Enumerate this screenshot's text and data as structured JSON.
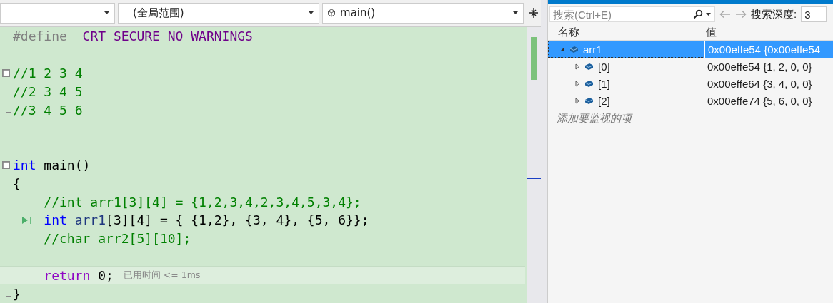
{
  "editor": {
    "nav": {
      "scope": "(全局范围)",
      "member": "main()"
    },
    "lines": [
      {
        "kind": "code",
        "tokens": [
          {
            "kind": "pre",
            "text": "#define "
          },
          {
            "kind": "macro",
            "text": "_CRT_SECURE_NO_WARNINGS"
          }
        ]
      },
      {
        "kind": "blank"
      },
      {
        "kind": "code",
        "collapsible": true,
        "tokens": [
          {
            "kind": "comment",
            "text": "//1 2 3 4"
          }
        ]
      },
      {
        "kind": "code",
        "in_region": true,
        "tokens": [
          {
            "kind": "comment",
            "text": "//2 3 4 5"
          }
        ]
      },
      {
        "kind": "code",
        "in_region": true,
        "tokens": [
          {
            "kind": "comment",
            "text": "//3 4 5 6"
          }
        ]
      },
      {
        "kind": "blank"
      },
      {
        "kind": "blank"
      },
      {
        "kind": "code",
        "collapsible": true,
        "tokens": [
          {
            "kind": "keyword",
            "text": "int"
          },
          {
            "kind": "plain",
            "text": " main()"
          }
        ]
      },
      {
        "kind": "code",
        "in_region": true,
        "tokens": [
          {
            "kind": "plain",
            "text": "{"
          }
        ]
      },
      {
        "kind": "code",
        "in_region": true,
        "indented": true,
        "tokens": [
          {
            "kind": "comment",
            "text": "//int arr1[3][4] = {1,2,3,4,2,3,4,5,3,4};"
          }
        ]
      },
      {
        "kind": "code",
        "in_region": true,
        "indented": true,
        "marker": true,
        "tokens": [
          {
            "kind": "keyword",
            "text": "int"
          },
          {
            "kind": "ident",
            "text": " arr1"
          },
          {
            "kind": "plain",
            "text": "[3][4] = { {1,2}, {3, 4}, {5, 6}};"
          }
        ]
      },
      {
        "kind": "code",
        "in_region": true,
        "indented": true,
        "tokens": [
          {
            "kind": "comment",
            "text": "//char arr2[5][10];"
          }
        ]
      },
      {
        "kind": "blank",
        "in_region": true
      },
      {
        "kind": "code",
        "in_region": true,
        "indented": true,
        "current": true,
        "tokens": [
          {
            "kind": "control",
            "text": "return"
          },
          {
            "kind": "plain",
            "text": " 0;"
          },
          {
            "kind": "hint",
            "text": "已用时间 <= 1ms"
          }
        ]
      },
      {
        "kind": "code",
        "in_region": true,
        "tokens": [
          {
            "kind": "plain",
            "text": "}"
          }
        ]
      }
    ]
  },
  "watch": {
    "search": {
      "placeholder": "搜索(Ctrl+E)"
    },
    "depth_label": "搜索深度:",
    "depth": "3",
    "columns": [
      "名称",
      "值"
    ],
    "rows": [
      {
        "name": "arr1",
        "value": "0x00effe54 {0x00effe54",
        "expanded": true,
        "selected": true,
        "children": [
          {
            "name": "[0]",
            "value": "0x00effe54 {1, 2, 0, 0}",
            "expanded": false,
            "selected": false
          },
          {
            "name": "[1]",
            "value": "0x00effe64 {3, 4, 0, 0}",
            "expanded": false,
            "selected": false
          },
          {
            "name": "[2]",
            "value": "0x00effe74 {5, 6, 0, 0}",
            "expanded": false,
            "selected": false
          }
        ]
      }
    ],
    "add_item": "添加要监视的项"
  }
}
